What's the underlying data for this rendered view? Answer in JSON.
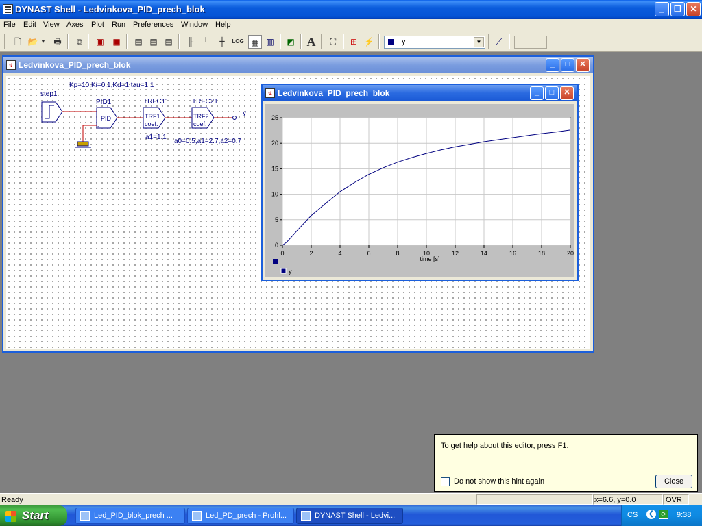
{
  "app": {
    "title": "DYNAST Shell - Ledvinkova_PID_prech_blok",
    "caption_buttons": [
      "minimize-icon",
      "restore-icon",
      "close-icon"
    ]
  },
  "menu": [
    "File",
    "Edit",
    "View",
    "Axes",
    "Plot",
    "Run",
    "Preferences",
    "Window",
    "Help"
  ],
  "toolbar": {
    "icons": [
      "new-file-icon",
      "open-folder-icon",
      "dropdown-arrow-icon",
      "print-icon",
      "copy-icon",
      "model-icon",
      "model-alt-icon",
      "edit-icon",
      "page-icon",
      "page-alt-icon",
      "page-step-icon",
      "axes-icon",
      "axes-scale-icon",
      "xy-axes-icon",
      "log-scale-icon",
      "grid-icon",
      "bars-icon",
      "zoom-icon",
      "text-font-icon",
      "fit-icon",
      "table-icon",
      "marker-icon",
      "axis-pick-icon"
    ],
    "log_label": "LOG",
    "font_label": "A",
    "combo_value": "y",
    "combo_color": "#000080"
  },
  "editor_window": {
    "title": "Ledvinkova_PID_prech_blok",
    "params_label": "Kp=10,Ki=0.1,Kd=1,tau=1.1",
    "blocks": [
      {
        "name": "step1"
      },
      {
        "name": "PID1",
        "inner": "PID"
      },
      {
        "name": "TRFC11",
        "inner_1": "TRF1",
        "inner_2": "coef.",
        "param": "a1=1.1"
      },
      {
        "name": "TRFC21",
        "inner_1": "TRF2",
        "inner_2": "coef.",
        "param": "a0=0.5,a1=2.7,a2=0.7"
      }
    ],
    "output_label": "y",
    "plus_sign": "+",
    "minus_sign": "-"
  },
  "plot_window": {
    "title": "Ledvinkova_PID_prech_blok",
    "legend_label": "y",
    "series_color": "#000080"
  },
  "chart_data": {
    "type": "line",
    "xlabel": "time [s]",
    "ylabel": "",
    "xlim": [
      0,
      20
    ],
    "ylim": [
      0,
      25
    ],
    "xticks": [
      0,
      2,
      4,
      6,
      8,
      10,
      12,
      14,
      16,
      18,
      20
    ],
    "yticks": [
      0,
      5,
      10,
      15,
      20,
      25
    ],
    "grid": true,
    "series": [
      {
        "name": "y",
        "x": [
          0,
          0.3,
          1,
          2,
          3,
          4,
          5,
          6,
          7,
          8,
          9,
          10,
          11,
          12,
          13,
          14,
          15,
          16,
          17,
          18,
          19,
          20
        ],
        "y": [
          0,
          0.6,
          2.8,
          5.8,
          8.2,
          10.5,
          12.3,
          13.9,
          15.2,
          16.3,
          17.2,
          18.0,
          18.7,
          19.3,
          19.8,
          20.3,
          20.7,
          21.1,
          21.5,
          21.9,
          22.2,
          22.6
        ]
      }
    ]
  },
  "hint": {
    "text": "To get help about this editor, press F1.",
    "checkbox_label": "Do not show this hint again",
    "close_label": "Close"
  },
  "status": {
    "left": "Ready",
    "coords": "x=6.6, y=0.0",
    "mode": "OVR"
  },
  "taskbar": {
    "start_label": "Start",
    "tasks": [
      {
        "label": "Led_PID_blok_prech ..."
      },
      {
        "label": "Led_PD_prech - Prohl..."
      },
      {
        "label": "DYNAST Shell - Ledvi..."
      }
    ],
    "language": "CS",
    "clock": "9:38"
  }
}
